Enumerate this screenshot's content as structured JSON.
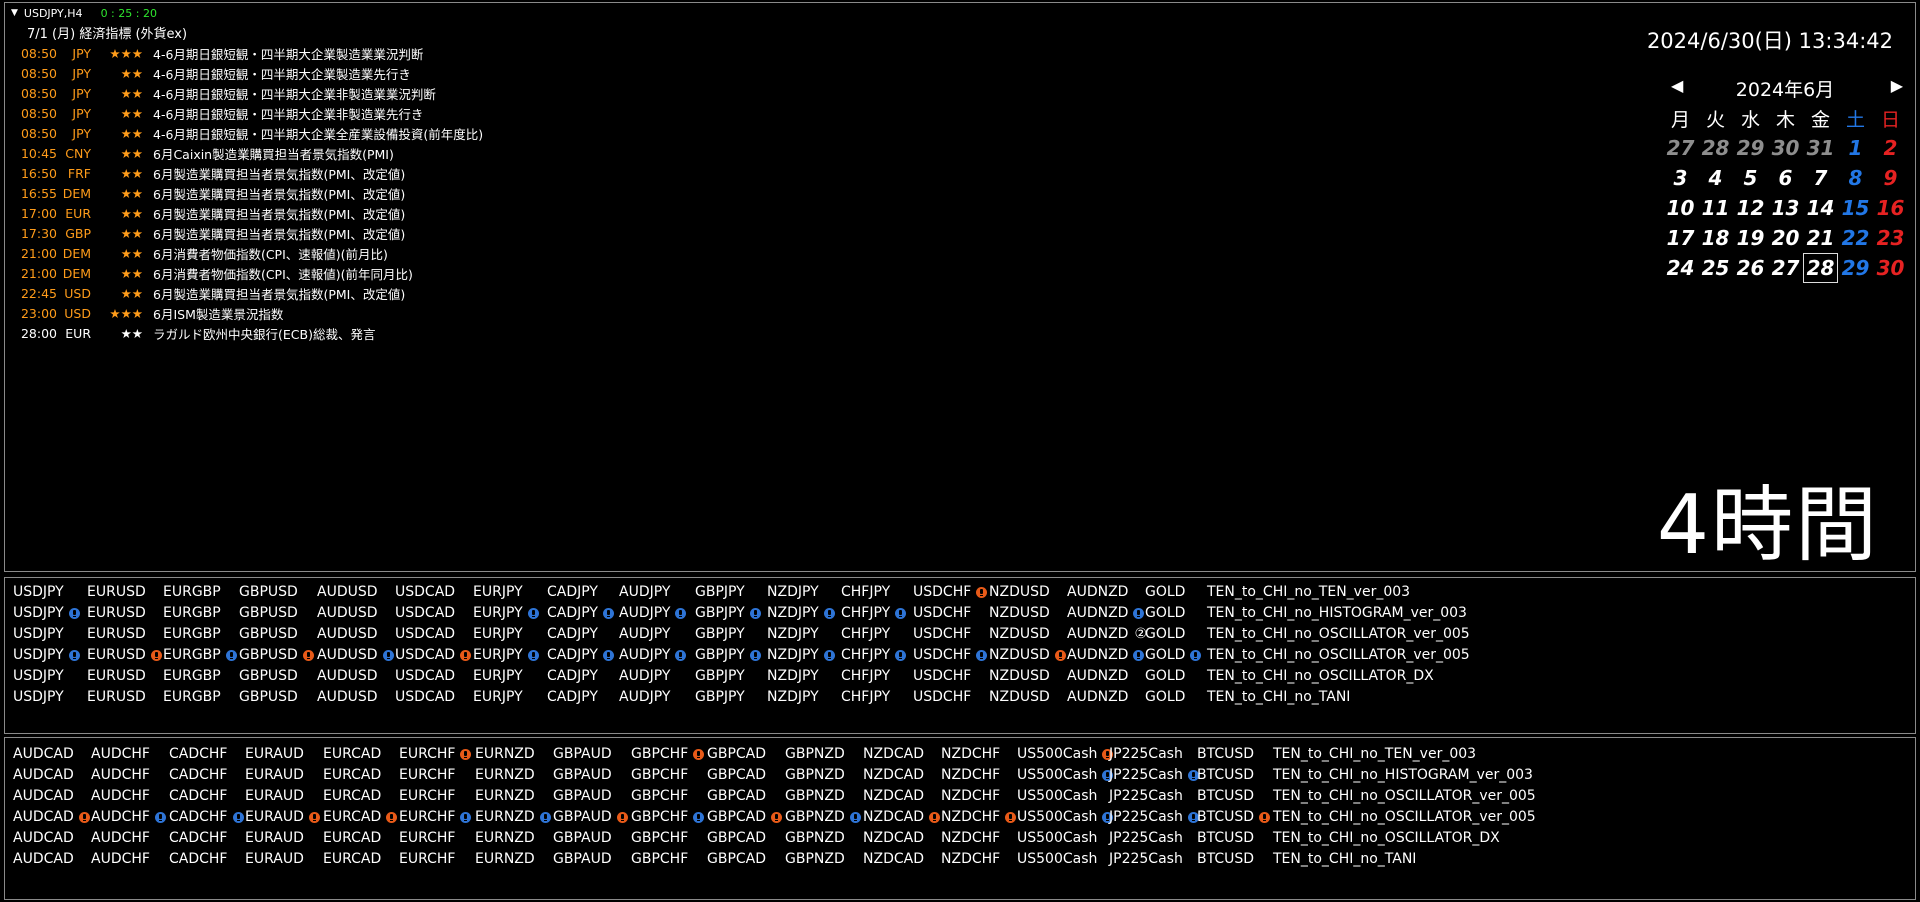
{
  "header": {
    "symbol": "USDJPY,H4",
    "timer": "0 : 25 : 20",
    "calendar_title": "7/1 (月) 経済指標 (外貨ex)"
  },
  "datetime": "2024/6/30(日) 13:34:42",
  "events": [
    {
      "time": "08:50",
      "cur": "JPY",
      "stars": "★★★",
      "title": "4-6月期日銀短観・四半期大企業製造業業況判断",
      "color": "orange"
    },
    {
      "time": "08:50",
      "cur": "JPY",
      "stars": "★★",
      "title": "4-6月期日銀短観・四半期大企業製造業先行き",
      "color": "orange"
    },
    {
      "time": "08:50",
      "cur": "JPY",
      "stars": "★★",
      "title": "4-6月期日銀短観・四半期大企業非製造業業況判断",
      "color": "orange"
    },
    {
      "time": "08:50",
      "cur": "JPY",
      "stars": "★★",
      "title": "4-6月期日銀短観・四半期大企業非製造業先行き",
      "color": "orange"
    },
    {
      "time": "08:50",
      "cur": "JPY",
      "stars": "★★",
      "title": "4-6月期日銀短観・四半期大企業全産業設備投資(前年度比)",
      "color": "orange"
    },
    {
      "time": "10:45",
      "cur": "CNY",
      "stars": "★★",
      "title": "6月Caixin製造業購買担当者景気指数(PMI)",
      "color": "orange"
    },
    {
      "time": "16:50",
      "cur": "FRF",
      "stars": "★★",
      "title": "6月製造業購買担当者景気指数(PMI、改定値)",
      "color": "orange"
    },
    {
      "time": "16:55",
      "cur": "DEM",
      "stars": "★★",
      "title": "6月製造業購買担当者景気指数(PMI、改定値)",
      "color": "orange"
    },
    {
      "time": "17:00",
      "cur": "EUR",
      "stars": "★★",
      "title": "6月製造業購買担当者景気指数(PMI、改定値)",
      "color": "orange"
    },
    {
      "time": "17:30",
      "cur": "GBP",
      "stars": "★★",
      "title": "6月製造業購買担当者景気指数(PMI、改定値)",
      "color": "orange"
    },
    {
      "time": "21:00",
      "cur": "DEM",
      "stars": "★★",
      "title": "6月消費者物価指数(CPI、速報値)(前月比)",
      "color": "orange"
    },
    {
      "time": "21:00",
      "cur": "DEM",
      "stars": "★★",
      "title": "6月消費者物価指数(CPI、速報値)(前年同月比)",
      "color": "orange"
    },
    {
      "time": "22:45",
      "cur": "USD",
      "stars": "★★",
      "title": "6月製造業購買担当者景気指数(PMI、改定値)",
      "color": "orange"
    },
    {
      "time": "23:00",
      "cur": "USD",
      "stars": "★★★",
      "title": "6月ISM製造業景況指数",
      "color": "orange"
    },
    {
      "time": "28:00",
      "cur": "EUR",
      "stars": "★★",
      "title": "ラガルド欧州中央銀行(ECB)総裁、発言",
      "color": "white"
    }
  ],
  "calendar": {
    "prev": "◀",
    "next": "▶",
    "month": "2024年6月",
    "weekdays": [
      "月",
      "火",
      "水",
      "木",
      "金",
      "土",
      "日"
    ],
    "weeks": [
      [
        "27",
        "28",
        "29",
        "30",
        "31",
        "1",
        "2"
      ],
      [
        "3",
        "4",
        "5",
        "6",
        "7",
        "8",
        "9"
      ],
      [
        "10",
        "11",
        "12",
        "13",
        "14",
        "15",
        "16"
      ],
      [
        "17",
        "18",
        "19",
        "20",
        "21",
        "22",
        "23"
      ],
      [
        "24",
        "25",
        "26",
        "27",
        "28",
        "29",
        "30"
      ]
    ],
    "today": "28"
  },
  "timeframe_label": "4時間",
  "panel_a": {
    "columns": [
      "USDJPY",
      "EURUSD",
      "EURGBP",
      "GBPUSD",
      "AUDUSD",
      "USDCAD",
      "EURJPY",
      "CADJPY",
      "AUDJPY",
      "GBPJPY",
      "NZDJPY",
      "CHFJPY",
      "USDCHF",
      "NZDUSD",
      "AUDNZD",
      "GOLD"
    ],
    "rows": [
      {
        "indicator": "TEN_to_CHI_no_TEN_ver_003",
        "signals": [
          "",
          "",
          "",
          "",
          "",
          "",
          "",
          "",
          "",
          "",
          "",
          "",
          "dn",
          "",
          "",
          ""
        ]
      },
      {
        "indicator": "TEN_to_CHI_no_HISTOGRAM_ver_003",
        "signals": [
          "up",
          "",
          "",
          "",
          "",
          "",
          "up",
          "up",
          "up",
          "up",
          "up",
          "up",
          "",
          "",
          "up",
          ""
        ]
      },
      {
        "indicator": "TEN_to_CHI_no_OSCILLATOR_ver_005",
        "signals": [
          "",
          "",
          "",
          "",
          "",
          "",
          "",
          "",
          "",
          "",
          "",
          "",
          "",
          "",
          "two",
          ""
        ]
      },
      {
        "indicator": "TEN_to_CHI_no_OSCILLATOR_ver_005",
        "signals": [
          "up",
          "dn",
          "up",
          "dn",
          "up",
          "dn",
          "up",
          "up",
          "up",
          "up",
          "up",
          "up",
          "up",
          "dn",
          "up",
          "up"
        ]
      },
      {
        "indicator": "TEN_to_CHI_no_OSCILLATOR_DX",
        "signals": [
          "",
          "",
          "",
          "",
          "",
          "",
          "",
          "",
          "",
          "",
          "",
          "",
          "",
          "",
          "",
          ""
        ]
      },
      {
        "indicator": "TEN_to_CHI_no_TANI",
        "signals": [
          "",
          "",
          "",
          "",
          "",
          "",
          "",
          "",
          "",
          "",
          "",
          "",
          "",
          "",
          "",
          ""
        ]
      }
    ],
    "two_symbol": "②"
  },
  "panel_b": {
    "columns": [
      "AUDCAD",
      "AUDCHF",
      "CADCHF",
      "EURAUD",
      "EURCAD",
      "EURCHF",
      "EURNZD",
      "GBPAUD",
      "GBPCHF",
      "GBPCAD",
      "GBPNZD",
      "NZDCAD",
      "NZDCHF",
      "US500Cash",
      "JP225Cash",
      "BTCUSD"
    ],
    "rows": [
      {
        "indicator": "TEN_to_CHI_no_TEN_ver_003",
        "signals": [
          "",
          "",
          "",
          "",
          "",
          "dn",
          "",
          "",
          "dn",
          "",
          "",
          "",
          "",
          "dn",
          "",
          ""
        ]
      },
      {
        "indicator": "TEN_to_CHI_no_HISTOGRAM_ver_003",
        "signals": [
          "",
          "",
          "",
          "",
          "",
          "",
          "",
          "",
          "",
          "",
          "",
          "",
          "",
          "up",
          "up",
          ""
        ]
      },
      {
        "indicator": "TEN_to_CHI_no_OSCILLATOR_ver_005",
        "signals": [
          "",
          "",
          "",
          "",
          "",
          "",
          "",
          "",
          "",
          "",
          "",
          "",
          "",
          "",
          "",
          ""
        ]
      },
      {
        "indicator": "TEN_to_CHI_no_OSCILLATOR_ver_005",
        "signals": [
          "dn",
          "up",
          "up",
          "dn",
          "dn",
          "up",
          "up",
          "dn",
          "up",
          "dn",
          "up",
          "dn",
          "dn",
          "up",
          "up",
          "dn"
        ]
      },
      {
        "indicator": "TEN_to_CHI_no_OSCILLATOR_DX",
        "signals": [
          "",
          "",
          "",
          "",
          "",
          "",
          "",
          "",
          "",
          "",
          "",
          "",
          "",
          "",
          "",
          ""
        ]
      },
      {
        "indicator": "TEN_to_CHI_no_TANI",
        "signals": [
          "",
          "",
          "",
          "",
          "",
          "",
          "",
          "",
          "",
          "",
          "",
          "",
          "",
          "",
          "",
          ""
        ]
      }
    ]
  },
  "colors": {
    "orange": "#ff9c1a",
    "saturday": "#2277e6",
    "sunday": "#e62222",
    "signal_up": "#2e74d6",
    "signal_down": "#e85a18",
    "timer": "#2ee62e"
  }
}
